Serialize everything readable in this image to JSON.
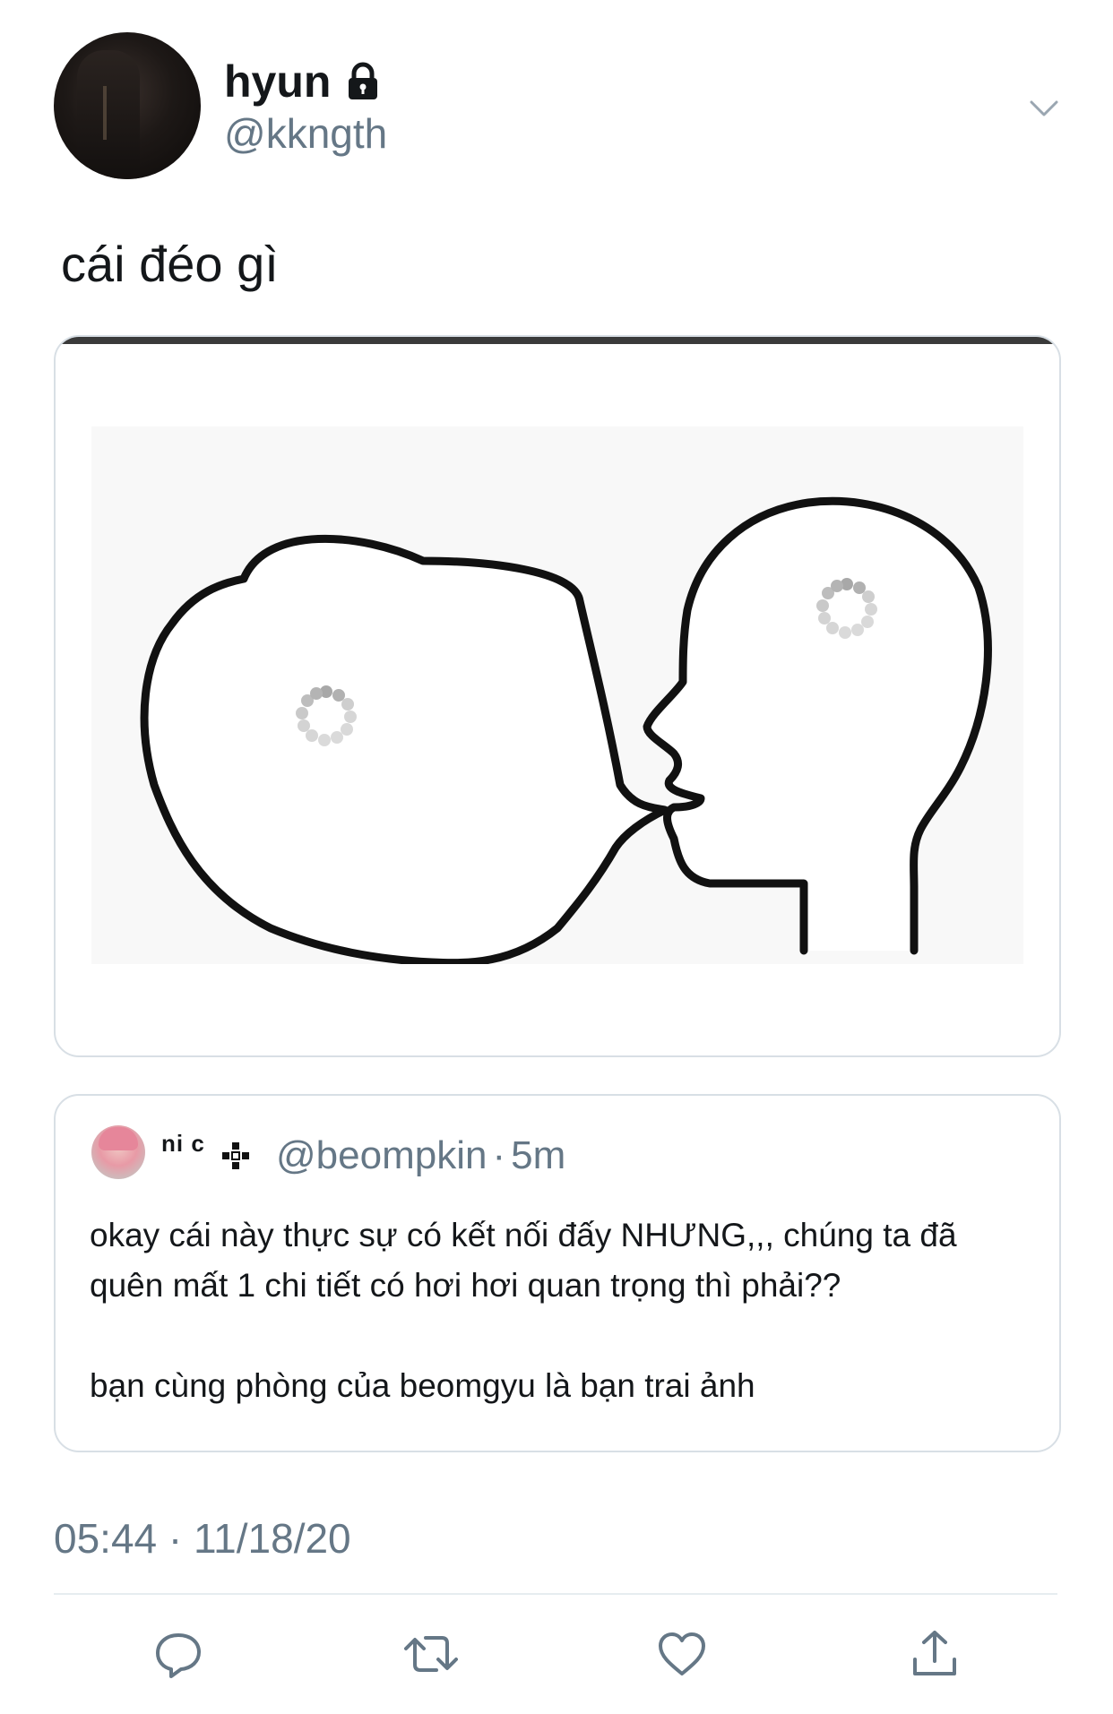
{
  "tweet": {
    "display_name": "hyun",
    "handle": "@kkngth",
    "text": "cái đéo gì",
    "timestamp": "05:44 · 11/18/20"
  },
  "quote": {
    "display_name": "ni c",
    "handle": "@beompkin",
    "time": "5m",
    "dot": "·",
    "text_line1": "okay cái này thực sự có kết nối đấy NHƯNG,,, chúng ta đã quên mất 1 chi tiết có hơi hơi quan trọng thì phải??",
    "text_line2": "bạn cùng phòng của beomgyu là bạn trai ảnh"
  },
  "icons": {
    "lock": "lock-icon",
    "chevron": "chevron-down-icon",
    "reply": "reply-icon",
    "retweet": "retweet-icon",
    "like": "heart-icon",
    "share": "share-icon"
  },
  "colors": {
    "text": "#14171a",
    "secondary": "#657786",
    "border": "#d8dfe5",
    "divider": "#e6ecf0"
  }
}
